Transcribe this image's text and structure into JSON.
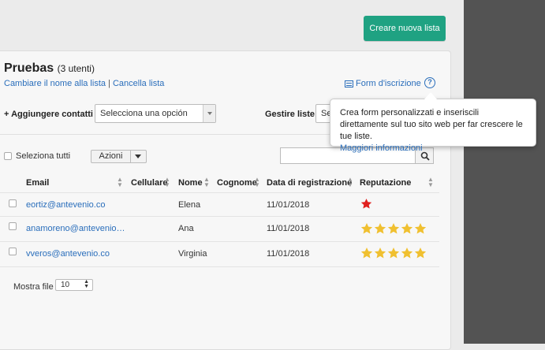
{
  "header": {
    "create_button": "Creare nuova lista"
  },
  "list": {
    "title": "Pruebas",
    "count": "(3 utenti)",
    "rename_link": "Cambiare il nome alla lista",
    "separator": "|",
    "delete_link": "Cancella lista",
    "form_link": "Form d'iscrizione",
    "help_glyph": "?"
  },
  "tooltip": {
    "text": "Crea form personalizzati e inseriscili direttamente sul tuo sito web per far crescere le tue liste.",
    "link": "Maggiori informazioni"
  },
  "controls": {
    "add_contacts_label": "+ Aggiungere contatti",
    "add_contacts_select": "Selecciona una opción",
    "manage_lists_label": "Gestire liste",
    "manage_lists_select": "Se",
    "select_all": "Seleziona tutti",
    "actions_button": "Azioni",
    "search_placeholder": ""
  },
  "table": {
    "columns": [
      "Email",
      "Cellulare",
      "Nome",
      "Cognome",
      "Data di registrazione",
      "Reputazione"
    ],
    "rows": [
      {
        "email": "eortiz@antevenio.co",
        "cellulare": "",
        "nome": "Elena",
        "cognome": "",
        "data": "11/01/2018",
        "stars": 1
      },
      {
        "email": "anamoreno@antevenio…",
        "cellulare": "",
        "nome": "Ana",
        "cognome": "",
        "data": "11/01/2018",
        "stars": 5
      },
      {
        "email": "vveros@antevenio.co",
        "cellulare": "",
        "nome": "Virginia",
        "cognome": "",
        "data": "11/01/2018",
        "stars": 5
      }
    ]
  },
  "footer": {
    "rows_label": "Mostra file",
    "rows_value": "10"
  },
  "colors": {
    "accent": "#1fa282",
    "link": "#2a6ebb",
    "star_gold": "#f0c030",
    "star_red": "#e0201e"
  }
}
